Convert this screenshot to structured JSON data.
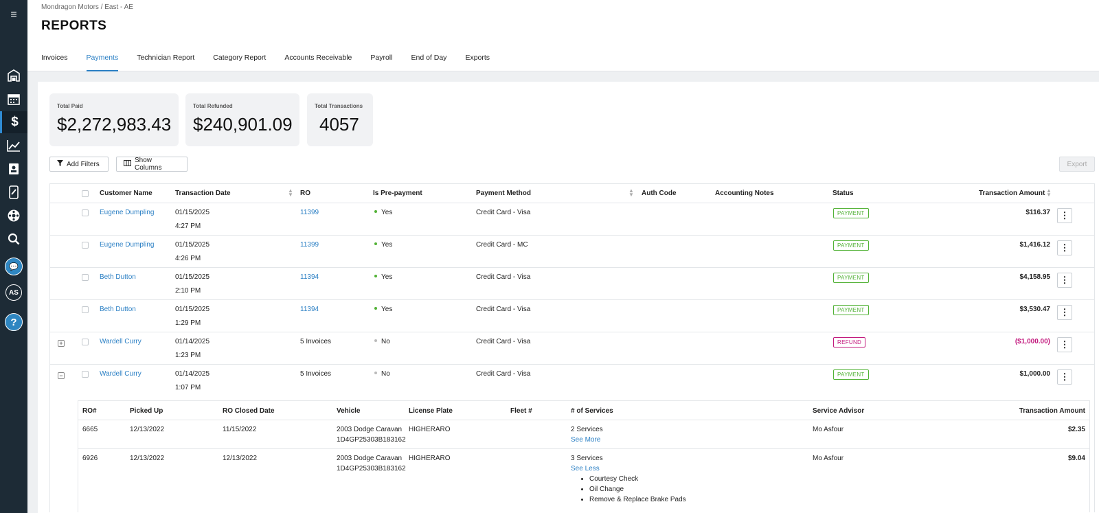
{
  "sidebar": {
    "items": [
      {
        "name": "shop-icon",
        "glyph": "⛩"
      },
      {
        "name": "calendar-icon",
        "glyph": "▦"
      },
      {
        "name": "dollar-icon",
        "glyph": "$"
      },
      {
        "name": "chart-icon",
        "glyph": "📈"
      },
      {
        "name": "contacts-icon",
        "glyph": "▤"
      },
      {
        "name": "parts-icon",
        "glyph": "▮"
      },
      {
        "name": "tire-icon",
        "glyph": "⚙"
      },
      {
        "name": "search-icon",
        "glyph": "⌕"
      }
    ],
    "avatar": "AS",
    "help": "?"
  },
  "header": {
    "breadcrumb": "Mondragon Motors / East - AE",
    "title": "REPORTS",
    "tabs": [
      "Invoices",
      "Payments",
      "Technician Report",
      "Category Report",
      "Accounts Receivable",
      "Payroll",
      "End of Day",
      "Exports"
    ],
    "active_tab": "Payments"
  },
  "stats": {
    "paid": {
      "label": "Total Paid",
      "value": "$2,272,983.43"
    },
    "refunded": {
      "label": "Total Refunded",
      "value": "$240,901.09"
    },
    "transactions": {
      "label": "Total Transactions",
      "value": "4057"
    }
  },
  "toolbar": {
    "add_filters": "Add Filters",
    "show_columns": "Show Columns",
    "export": "Export"
  },
  "table": {
    "columns": [
      "Customer Name",
      "Transaction Date",
      "RO",
      "Is Pre-payment",
      "Payment Method",
      "Auth Code",
      "Accounting Notes",
      "Status",
      "Transaction Amount"
    ],
    "rows": [
      {
        "customer": "Eugene Dumpling",
        "date": "01/15/2025",
        "time": "4:27 PM",
        "ro": "11399",
        "prepay": "Yes",
        "method": "Credit Card - Visa",
        "status": "PAYMENT",
        "amount": "$116.37"
      },
      {
        "customer": "Eugene Dumpling",
        "date": "01/15/2025",
        "time": "4:26 PM",
        "ro": "11399",
        "prepay": "Yes",
        "method": "Credit Card - MC",
        "status": "PAYMENT",
        "amount": "$1,416.12"
      },
      {
        "customer": "Beth Dutton",
        "date": "01/15/2025",
        "time": "2:10 PM",
        "ro": "11394",
        "prepay": "Yes",
        "method": "Credit Card - Visa",
        "status": "PAYMENT",
        "amount": "$4,158.95"
      },
      {
        "customer": "Beth Dutton",
        "date": "01/15/2025",
        "time": "1:29 PM",
        "ro": "11394",
        "prepay": "Yes",
        "method": "Credit Card - Visa",
        "status": "PAYMENT",
        "amount": "$3,530.47"
      },
      {
        "customer": "Wardell Curry",
        "date": "01/14/2025",
        "time": "1:23 PM",
        "ro": "5 Invoices",
        "prepay": "No",
        "method": "Credit Card - Visa",
        "status": "REFUND",
        "amount": "($1,000.00)",
        "expander": "+"
      },
      {
        "customer": "Wardell Curry",
        "date": "01/14/2025",
        "time": "1:07 PM",
        "ro": "5 Invoices",
        "prepay": "No",
        "method": "Credit Card - Visa",
        "status": "PAYMENT",
        "amount": "$1,000.00",
        "expander": "−"
      }
    ]
  },
  "subtable": {
    "columns": [
      "RO#",
      "Picked Up",
      "RO Closed Date",
      "Vehicle",
      "License Plate",
      "Fleet #",
      "# of Services",
      "Service Advisor",
      "Transaction Amount"
    ],
    "rows": [
      {
        "ro": "6665",
        "picked_up": "12/13/2022",
        "closed": "11/15/2022",
        "vehicle": "2003 Dodge Caravan",
        "vin": "1D4GP25303B183162",
        "plate": "HIGHERARO",
        "fleet": "",
        "services": "2 Services",
        "toggle": "See More",
        "advisor": "Mo Asfour",
        "amount": "$2.35"
      },
      {
        "ro": "6926",
        "picked_up": "12/13/2022",
        "closed": "12/13/2022",
        "vehicle": "2003 Dodge Caravan",
        "vin": "1D4GP25303B183162",
        "plate": "HIGHERARO",
        "fleet": "",
        "services": "3 Services",
        "toggle": "See Less",
        "advisor": "Mo Asfour",
        "amount": "$9.04",
        "service_items": [
          "Courtesy Check",
          "Oil Change",
          "Remove & Replace Brake Pads"
        ]
      }
    ]
  },
  "colors": {
    "link": "#2a7fc4",
    "payment": "#52b236",
    "refund": "#c2187d",
    "yes_dot": "#52b236",
    "no_dot": "#bbbbbb"
  }
}
